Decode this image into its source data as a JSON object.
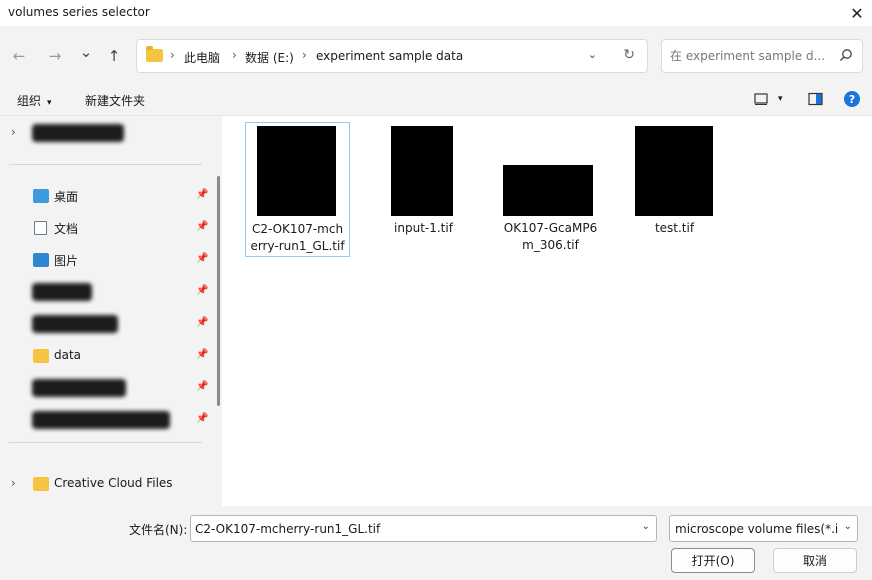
{
  "window": {
    "title": "volumes series selector",
    "close_glyph": "✕"
  },
  "nav": {
    "back_glyph": "←",
    "forward_glyph": "→",
    "recent_glyph": "⌄",
    "up_glyph": "↑"
  },
  "address": {
    "crumbs": [
      "此电脑",
      "数据 (E:)",
      "experiment sample data"
    ],
    "separator": "›",
    "dropdown_glyph": "⌄",
    "refresh_glyph": "↻"
  },
  "search": {
    "placeholder": "在 experiment sample d..."
  },
  "toolbar": {
    "organize_label": "组织",
    "new_folder_label": "新建文件夹",
    "caret": "▾",
    "help_glyph": "?"
  },
  "sidebar": {
    "items": [
      {
        "label": "桌面",
        "icon": "desktop-icon"
      },
      {
        "label": "文档",
        "icon": "document-icon"
      },
      {
        "label": "图片",
        "icon": "pictures-icon"
      },
      {
        "label": "data",
        "icon": "folder-icon"
      },
      {
        "label": "Creative Cloud Files",
        "icon": "creative-cloud-icon"
      }
    ],
    "pin_glyph": "📌",
    "chevron_glyph": "›"
  },
  "files": [
    {
      "name_line1": "C2-OK107-mch",
      "name_line2": "erry-run1_GL.tif",
      "selected": true
    },
    {
      "name_line1": "input-1.tif",
      "name_line2": "",
      "selected": false
    },
    {
      "name_line1": "OK107-GcaMP6",
      "name_line2": "m_306.tif",
      "selected": false
    },
    {
      "name_line1": "test.tif",
      "name_line2": "",
      "selected": false
    }
  ],
  "footer": {
    "filename_label": "文件名(N):",
    "filename_value": "C2-OK107-mcherry-run1_GL.tif",
    "filetype_value": "microscope volume files(*.im",
    "open_label": "打开(O)",
    "cancel_label": "取消",
    "dropdown_glyph": "⌄"
  },
  "colors": {
    "chrome": "#f3f3f3",
    "selection_border": "#99c9ef",
    "folder": "#f5c542",
    "help_icon": "#1a73d9"
  }
}
